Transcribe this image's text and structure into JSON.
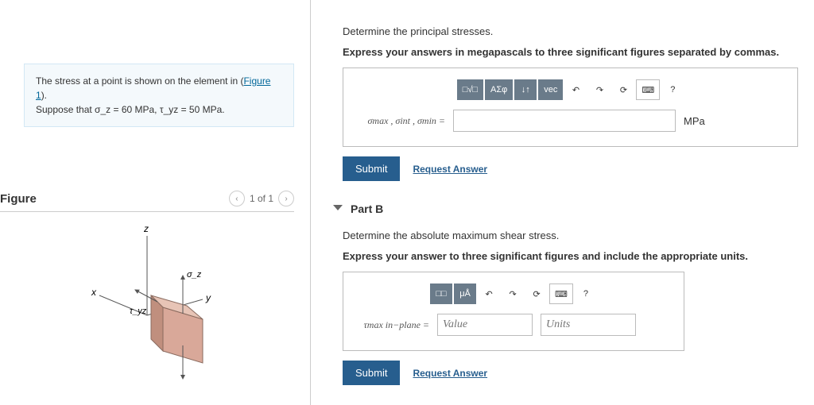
{
  "left": {
    "prompt_pre": "The stress at a point is shown on the element in (",
    "figure_link": "Figure 1",
    "prompt_post": ").",
    "suppose": "Suppose that σ_z = 60 MPa, τ_yz = 50 MPa.",
    "figure_heading": "Figure",
    "pager": "1 of 1",
    "axis_x": "x",
    "axis_y": "y",
    "axis_z": "z",
    "label_sigma": "σ_z",
    "label_tau": "τ_yz"
  },
  "partA": {
    "instr1": "Determine the principal stresses.",
    "instr2": "Express your answers in megapascals to three significant figures separated by commas.",
    "tools": {
      "t1": "□√□",
      "t2": "ΑΣφ",
      "t3": "↓↑",
      "t4": "vec",
      "undo": "↶",
      "redo": "↷",
      "reset": "⟳",
      "kbd": "⌨",
      "help": "?"
    },
    "lhs": "σmax , σint , σmin =",
    "unit": "MPa",
    "submit": "Submit",
    "request": "Request Answer"
  },
  "partB": {
    "title": "Part B",
    "instr1": "Determine the absolute maximum shear stress.",
    "instr2": "Express your answer to three significant figures and include the appropriate units.",
    "tools": {
      "t1": "□□",
      "t2": "μÅ",
      "undo": "↶",
      "redo": "↷",
      "reset": "⟳",
      "kbd": "⌨",
      "help": "?"
    },
    "lhs": "τmax in−plane =",
    "value_ph": "Value",
    "units_ph": "Units",
    "submit": "Submit",
    "request": "Request Answer"
  }
}
